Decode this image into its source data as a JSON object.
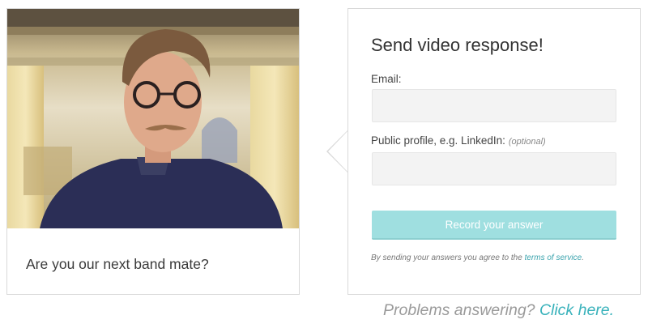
{
  "question_card": {
    "question": "Are you our next band mate?"
  },
  "form": {
    "title": "Send video response!",
    "email_label": "Email:",
    "email_value": "",
    "profile_label": "Public profile, e.g. LinkedIn:",
    "profile_optional": "(optional)",
    "profile_value": "",
    "record_button_label": "Record your answer",
    "tos_prefix": "By sending your answers you agree to the",
    "tos_link": "terms of service",
    "tos_suffix": "."
  },
  "footer": {
    "problems_text": "Problems answering?",
    "problems_link": "Click here."
  },
  "colors": {
    "accent": "#39b2bb",
    "button_bg": "#9fdfe0",
    "input_bg": "#f3f3f3",
    "border": "#d9d9d9"
  }
}
